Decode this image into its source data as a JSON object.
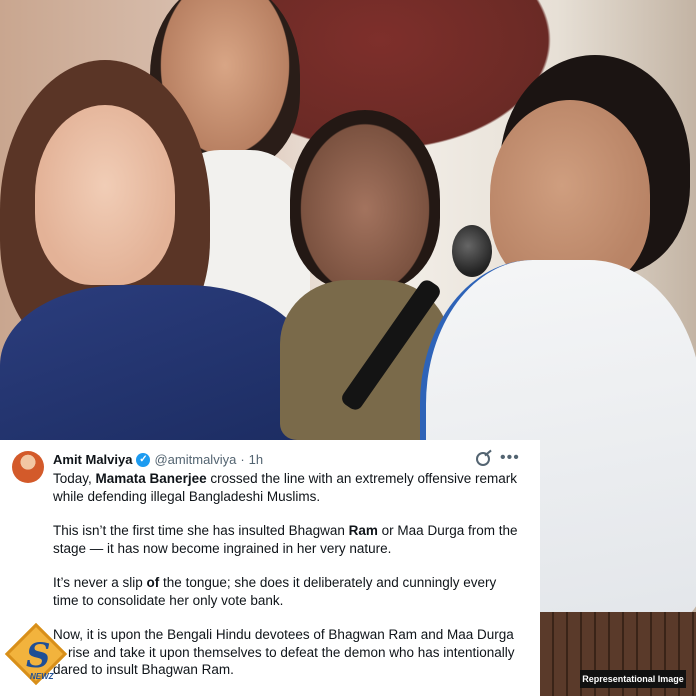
{
  "post": {
    "author_name": "Amit Malviya",
    "handle": "@amitmalviya",
    "separator": "·",
    "time": "1h",
    "paragraph1": {
      "pre": "Today, ",
      "bold": "Mamata Banerjee",
      "post": " crossed the line with an extremely offensive remark while defending illegal Bangladeshi Muslims."
    },
    "paragraph2": {
      "pre": "This isn’t the first time she has insulted Bhagwan ",
      "bold": "Ram",
      "post": " or Maa Durga from the stage — it has now become ingrained in her very nature."
    },
    "paragraph3": {
      "pre": "It’s never a slip ",
      "bold": "of",
      "post": " the tongue; she does it deliberately and cunningly every time to consolidate her only vote bank."
    },
    "paragraph4": "Now, it is upon the Bengali Hindu devotees of Bhagwan Ram and Maa Durga to rise and take it upon themselves to defeat the demon who has intentionally dared to insult Bhagwan Ram."
  },
  "watermark": {
    "logo_letter": "S",
    "logo_text": "NEWZ"
  },
  "badge": "Representational Image",
  "icons": {
    "verified": "verified-badge-icon",
    "grok": "grok-icon",
    "more": "more-icon"
  },
  "colors": {
    "verified_blue": "#1d9bf0",
    "secondary_text": "#536471",
    "primary_text": "#0f1419"
  }
}
